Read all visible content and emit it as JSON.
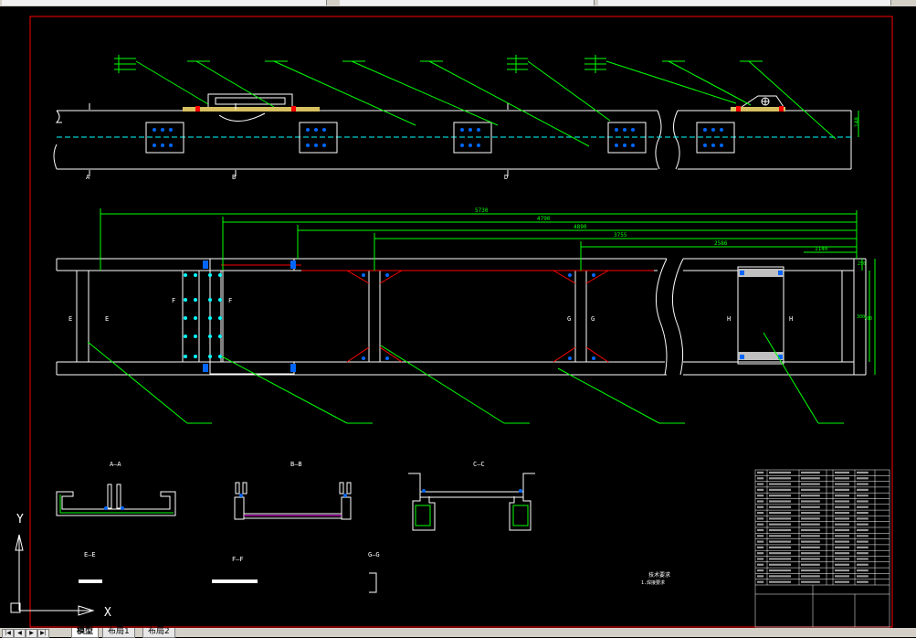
{
  "ucs": {
    "x_label": "X",
    "y_label": "Y"
  },
  "views": {
    "aa": "A—A",
    "bb": "B—B",
    "cc": "C—C",
    "ee": "E—E",
    "ff": "F—F",
    "gg": "G—G"
  },
  "dimensions": {
    "d1": "5730",
    "d2": "4790",
    "d3": "4890",
    "d4": "3755",
    "d5": "2586",
    "d6": "1140",
    "right1": "250",
    "right2": "300",
    "right3": "700",
    "top_right": "148"
  },
  "section_marks": {
    "a": "A",
    "b": "B",
    "d": "D",
    "e": "E",
    "f": "F",
    "g": "G",
    "h": "H"
  },
  "notes": {
    "title": "技术要求",
    "line1": "1.焊接要求"
  },
  "tabs": [
    {
      "label": "模型",
      "active": true
    },
    {
      "label": "布局1",
      "active": false
    },
    {
      "label": "布局2",
      "active": false
    }
  ],
  "colors": {
    "background": "#000000",
    "frame": "#ff0000",
    "geometry": "#ffffff",
    "leader": "#00ff00",
    "dimension": "#00ff00",
    "bolt": "#0066ff",
    "section": "#00ffff",
    "weld": "#d8c060"
  }
}
